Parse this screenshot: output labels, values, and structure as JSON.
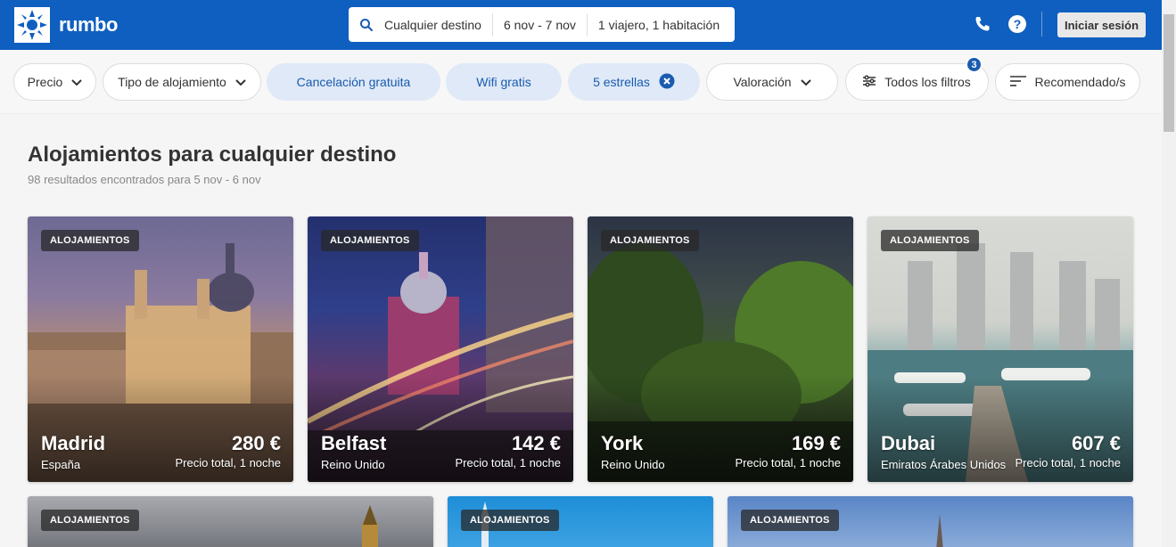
{
  "header": {
    "brand": "rumbo",
    "search": {
      "destination": "Cualquier destino",
      "dates": "6 nov - 7 nov",
      "guests": "1 viajero, 1 habitación"
    },
    "login_label": "Iniciar sesión",
    "icons": [
      "phone-icon",
      "help-icon"
    ]
  },
  "filters": {
    "price": "Precio",
    "type": "Tipo de alojamiento",
    "free_cancel": "Cancelación gratuita",
    "wifi": "Wifi gratis",
    "stars": "5 estrellas",
    "rating": "Valoración",
    "all_filters": "Todos los filtros",
    "all_filters_count": "3",
    "sort": "Recomendado/s"
  },
  "results": {
    "title": "Alojamientos para cualquier destino",
    "subtitle": "98 resultados encontrados para 5 nov - 6 nov"
  },
  "cards": [
    {
      "tag": "ALOJAMIENTOS",
      "city": "Madrid",
      "country": "España",
      "price": "280 €",
      "price_note": "Precio total, 1 noche"
    },
    {
      "tag": "ALOJAMIENTOS",
      "city": "Belfast",
      "country": "Reino Unido",
      "price": "142 €",
      "price_note": "Precio total, 1 noche"
    },
    {
      "tag": "ALOJAMIENTOS",
      "city": "York",
      "country": "Reino Unido",
      "price": "169 €",
      "price_note": "Precio total, 1 noche"
    },
    {
      "tag": "ALOJAMIENTOS",
      "city": "Dubai",
      "country": "Emiratos Árabes Unidos",
      "price": "607 €",
      "price_note": "Precio total, 1 noche"
    },
    {
      "tag": "ALOJAMIENTOS"
    },
    {
      "tag": "ALOJAMIENTOS"
    },
    {
      "tag": "ALOJAMIENTOS"
    }
  ],
  "colors": {
    "brand_blue": "#0f5fc0",
    "chip_active_bg": "#dfe9f7",
    "chip_active_text": "#1a5bb0"
  }
}
